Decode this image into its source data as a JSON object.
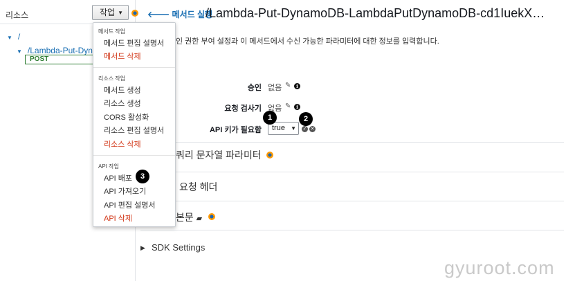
{
  "sidebar": {
    "title": "리소스",
    "actions_label": "작업",
    "tree": {
      "root": "/",
      "child": "/Lambda-Put-Dyna",
      "method": "POST"
    }
  },
  "menu": {
    "method_header": "메서드 작업",
    "method_items": [
      "메서드 편집 설명서",
      "메서드 삭제"
    ],
    "resource_header": "리소스 작업",
    "resource_items": [
      "메서드 생성",
      "리소스 생성",
      "CORS 활성화",
      "리소스 편집 설명서",
      "리소스 삭제"
    ],
    "api_header": "API 작업",
    "api_items": [
      "API 배포",
      "API 가져오기",
      "API 편집 설명서",
      "API 삭제"
    ]
  },
  "header": {
    "back_label": "메서드 실행",
    "back_arrow": "🡐",
    "title": "/Lambda-Put-DynamoDB-LambdaPutDynamoDB-cd1IuekX…"
  },
  "description": "인 권한 부여 설정과 이 메서드에서 수신 가능한 파라미터에 대한 정보를 입력합니다.",
  "fields": {
    "auth_label": "승인",
    "auth_value": "없음",
    "validator_label": "요청 검사기",
    "validator_value": "없음",
    "apikey_label": "API 키가 필요함",
    "apikey_value": "true"
  },
  "sections": {
    "query": "쿼리 문자열 파라미터",
    "headers": "요청 헤더",
    "body": "본문",
    "sdk": "SDK Settings"
  },
  "badges": [
    "1",
    "2",
    "3"
  ],
  "watermark": "gyuroot.com",
  "colors": {
    "link": "#1a6fb3",
    "danger": "#d13212",
    "post": "#2e7d32",
    "accent": "#ff9900"
  }
}
